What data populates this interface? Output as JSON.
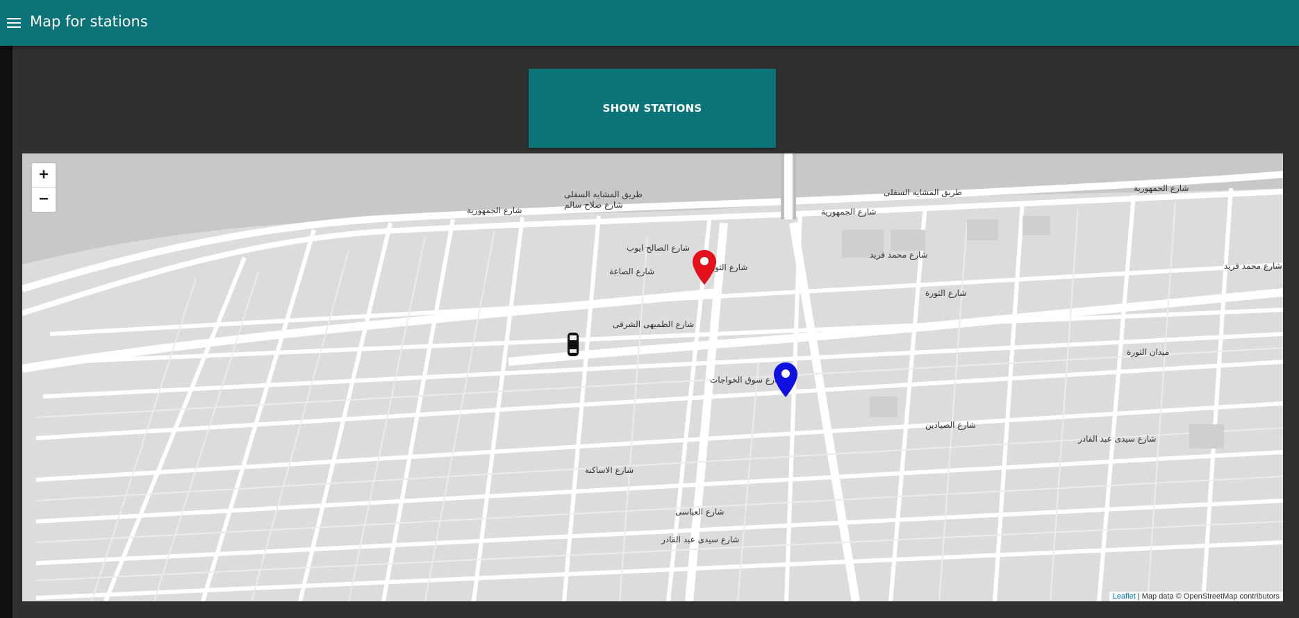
{
  "appbar": {
    "title": "Map for stations"
  },
  "actions": {
    "show_stations_label": "SHOW STATIONS"
  },
  "map": {
    "zoom_in_label": "+",
    "zoom_out_label": "−",
    "attribution_link": "Leaflet",
    "attribution_text": " | Map data © OpenStreetMap contributors",
    "markers": [
      {
        "name": "station-marker-red",
        "color": "#e3101c"
      },
      {
        "name": "station-marker-blue",
        "color": "#1010e0"
      },
      {
        "name": "car-marker",
        "color": "#111111"
      }
    ],
    "street_labels": [
      "طريق المشايه السفلى",
      "شارع صلاح سالم",
      "شارع الجمهورية",
      "شارع الصاعة",
      "شارع الثورة",
      "شارع محمد فريد",
      "شارع الصالح ايوب",
      "شارع الطميهى الشرقى",
      "شارع سوق الخواجات",
      "شارع سيدى عبد القادر",
      "شارع الصيادين",
      "ميدان الثورة",
      "شارع الاساكنة",
      "شارع العباسى"
    ]
  }
}
